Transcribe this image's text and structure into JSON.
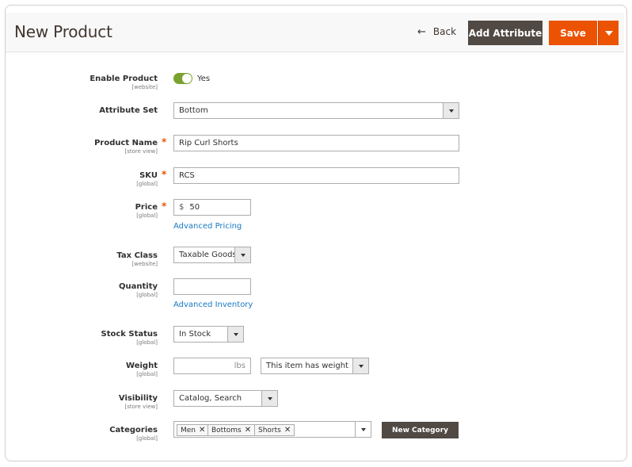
{
  "header": {
    "title": "New Product",
    "back_label": "Back",
    "add_attribute_label": "Add Attribute",
    "save_label": "Save"
  },
  "form": {
    "enable_product": {
      "label": "Enable Product",
      "scope": "[website]",
      "value": "Yes",
      "enabled": true
    },
    "attribute_set": {
      "label": "Attribute Set",
      "value": "Bottom"
    },
    "product_name": {
      "label": "Product Name",
      "scope": "[store view]",
      "value": "Rip Curl Shorts",
      "required_mark": "*"
    },
    "sku": {
      "label": "SKU",
      "scope": "[global]",
      "value": "RCS",
      "required_mark": "*"
    },
    "price": {
      "label": "Price",
      "scope": "[global]",
      "currency": "$",
      "value": "50",
      "required_mark": "*",
      "advanced_link": "Advanced Pricing"
    },
    "tax_class": {
      "label": "Tax Class",
      "scope": "[website]",
      "value": "Taxable Goods"
    },
    "quantity": {
      "label": "Quantity",
      "scope": "[global]",
      "value": "",
      "advanced_link": "Advanced Inventory"
    },
    "stock_status": {
      "label": "Stock Status",
      "scope": "[global]",
      "value": "In Stock"
    },
    "weight": {
      "label": "Weight",
      "scope": "[global]",
      "value": "",
      "unit": "lbs",
      "has_weight": "This item has weight"
    },
    "visibility": {
      "label": "Visibility",
      "scope": "[store view]",
      "value": "Catalog, Search"
    },
    "categories": {
      "label": "Categories",
      "scope": "[global]",
      "tags": [
        "Men",
        "Bottoms",
        "Shorts"
      ],
      "new_category_label": "New Category"
    }
  },
  "colors": {
    "accent": "#eb5202",
    "dark_button": "#514943",
    "toggle_on": "#79a22e",
    "link": "#1979c3"
  }
}
